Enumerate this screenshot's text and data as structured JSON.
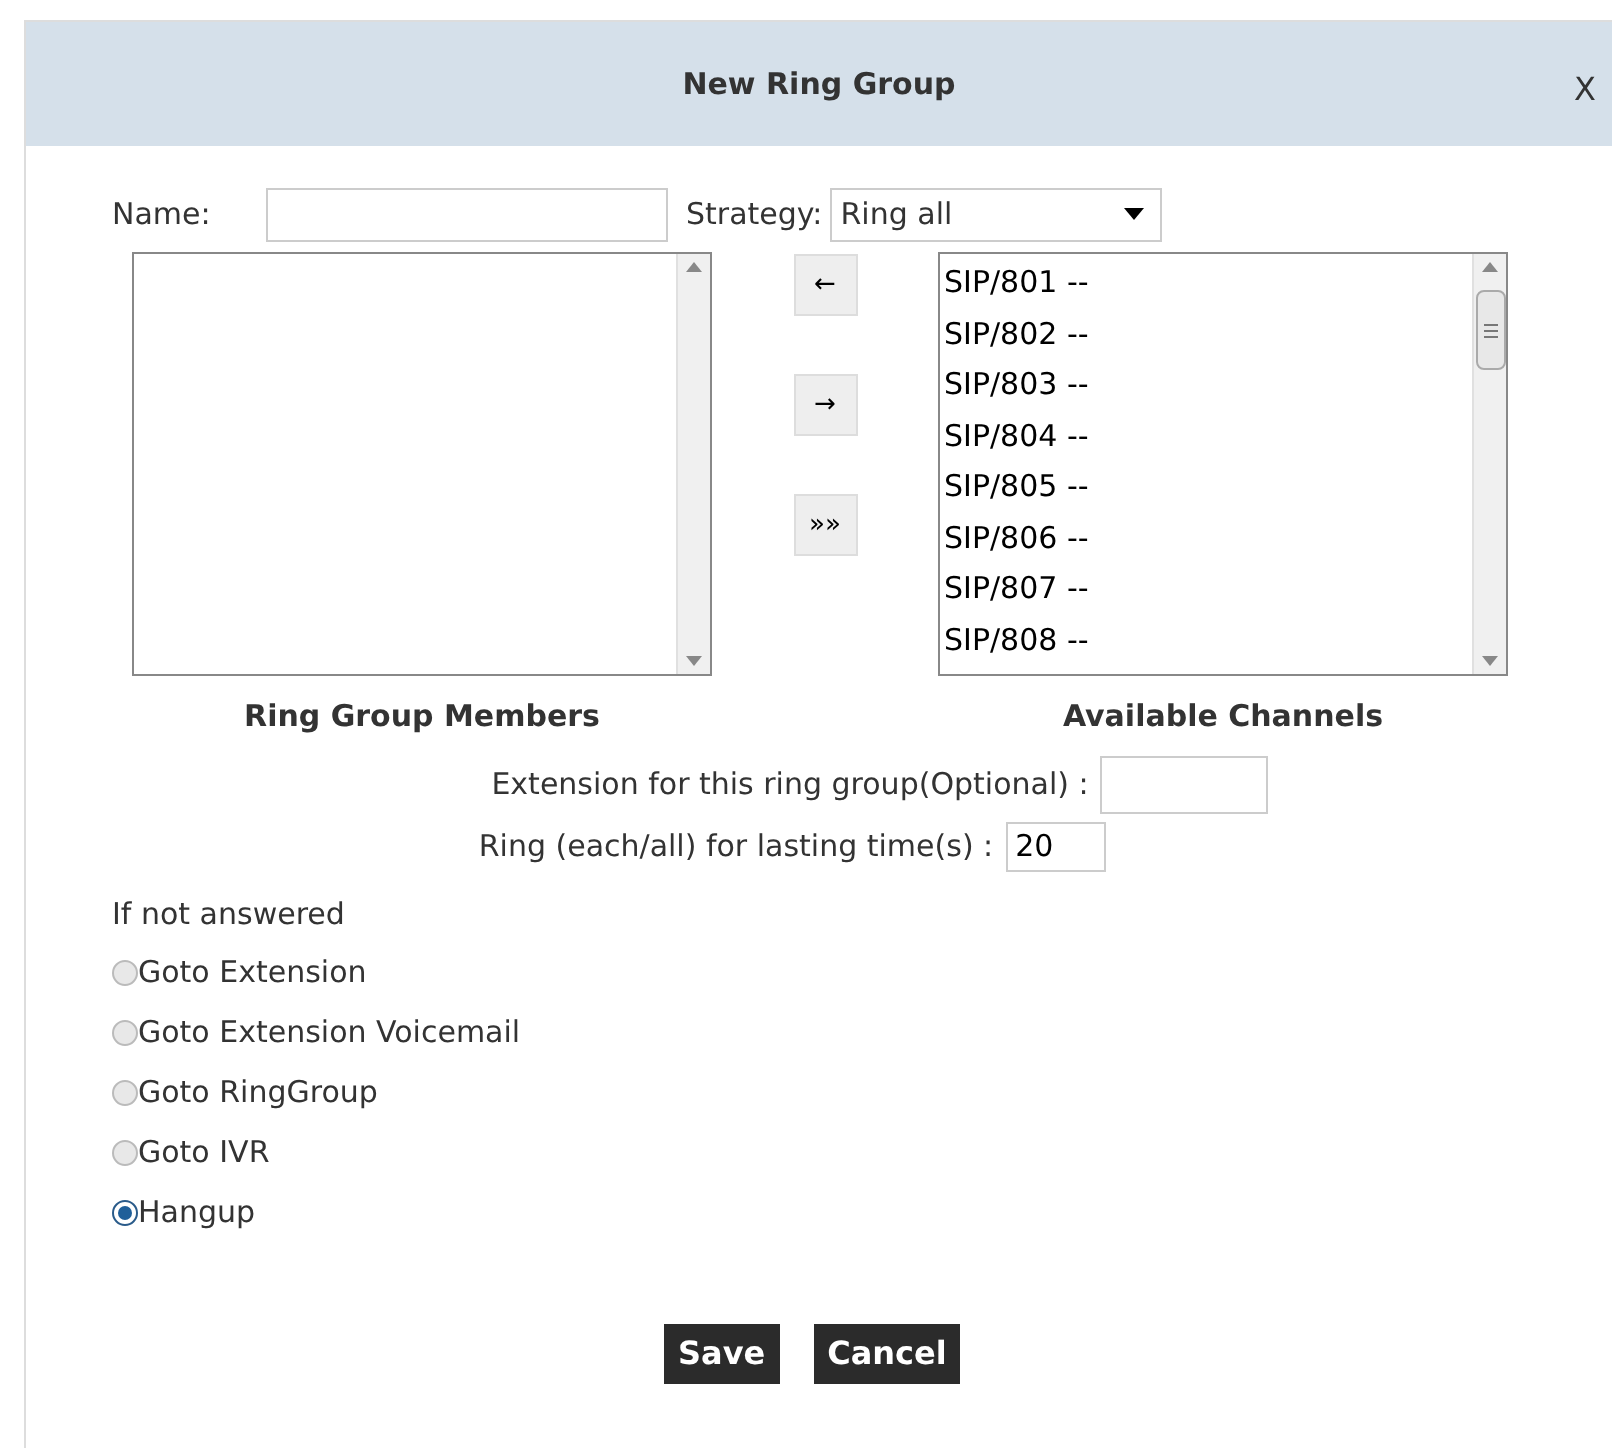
{
  "dialog": {
    "title": "New Ring Group",
    "close": "X"
  },
  "name_field": {
    "label": "Name:"
  },
  "strategy": {
    "label": "Strategy:",
    "value": "Ring all"
  },
  "members": {
    "label": "Ring Group Members"
  },
  "move_buttons": [
    "←",
    "→",
    "»»"
  ],
  "channels": {
    "label": "Available Channels",
    "items": [
      "SIP/801 --",
      "SIP/802 --",
      "SIP/803 --",
      "SIP/804 --",
      "SIP/805 --",
      "SIP/806 --",
      "SIP/807 --",
      "SIP/808 --"
    ]
  },
  "extension": {
    "label": "Extension for this ring group(Optional) :"
  },
  "ring_time": {
    "label": "Ring (each/all) for lasting time(s) :",
    "value": "20"
  },
  "if_not_answered": {
    "label": "If not answered",
    "options": [
      {
        "label": "Goto Extension",
        "selected": false
      },
      {
        "label": "Goto Extension Voicemail",
        "selected": false
      },
      {
        "label": "Goto RingGroup",
        "selected": false
      },
      {
        "label": "Goto IVR",
        "selected": false
      },
      {
        "label": "Hangup",
        "selected": true
      }
    ]
  },
  "buttons": [
    "Save",
    "Cancel"
  ]
}
